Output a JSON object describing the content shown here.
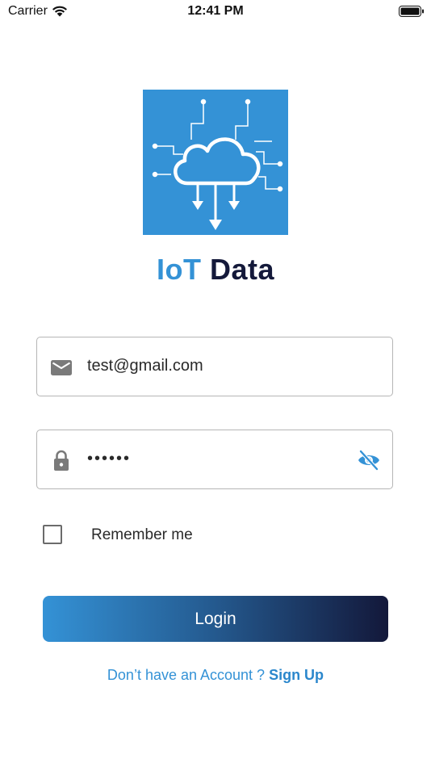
{
  "status_bar": {
    "carrier": "Carrier",
    "time": "12:41 PM",
    "icons": [
      "wifi-icon",
      "battery-icon"
    ]
  },
  "app": {
    "title_accent": "IoT",
    "title_main": "Data",
    "logo_icon": "cloud-circuit-icon"
  },
  "colors": {
    "accent": "#3492d6",
    "dark": "#14193a",
    "border": "#b5b5b5"
  },
  "form": {
    "email": {
      "icon": "mail-icon",
      "value": "test@gmail.com"
    },
    "password": {
      "icon": "lock-icon",
      "masked_value": "••••••",
      "toggle_icon": "eye-off-icon"
    },
    "remember_me": {
      "label": "Remember me",
      "checked": false
    },
    "login_label": "Login"
  },
  "footer": {
    "prompt": "Don’t have an Account ? ",
    "link": "Sign Up"
  }
}
